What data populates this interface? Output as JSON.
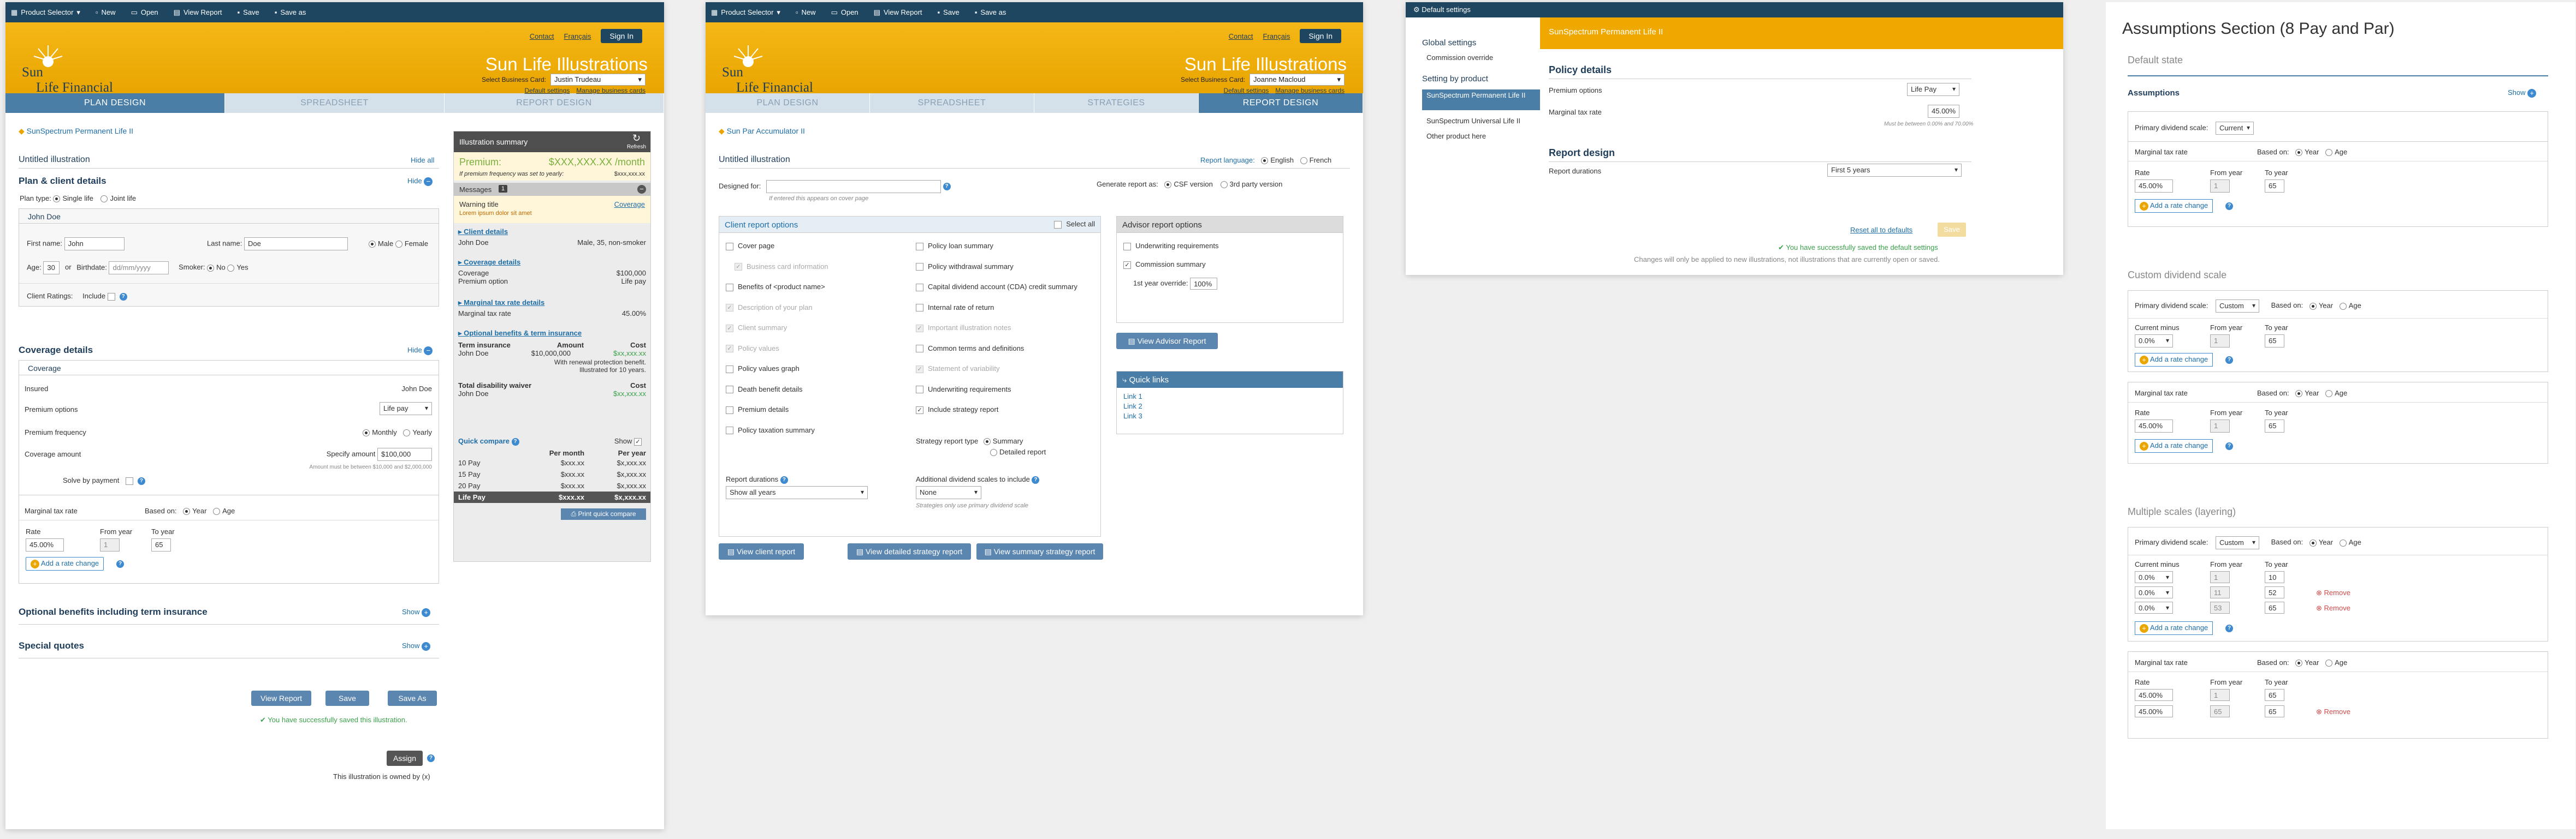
{
  "p1": {
    "toolbar": [
      "Product Selector",
      "New",
      "Open",
      "View Report",
      "Save",
      "Save as"
    ],
    "header": {
      "contact": "Contact",
      "francais": "Français",
      "signin": "Sign In",
      "title": "Sun Life Illustrations",
      "bc_label": "Select Business Card:",
      "bc_value": "Justin Trudeau",
      "default_settings": "Default settings",
      "manage_bc": "Manage business cards",
      "logo1": "Sun",
      "logo2": "Life Financial"
    },
    "tabs": [
      "PLAN DESIGN",
      "SPREADSHEET",
      "REPORT DESIGN"
    ],
    "product": "SunSpectrum Permanent Life II",
    "untitled": "Untitled illustration",
    "hide_all": "Hide all",
    "plan_client": "Plan & client details",
    "hide": "Hide",
    "plan_type": "Plan type:",
    "single": "Single life",
    "joint": "Joint life",
    "person": "John Doe",
    "first": "First name:",
    "first_v": "John",
    "last": "Last name:",
    "last_v": "Doe",
    "male": "Male",
    "female": "Female",
    "age": "Age:",
    "age_v": "30",
    "or": "or",
    "birth": "Birthdate:",
    "birth_ph": "dd/mm/yyyy",
    "smoker": "Smoker:",
    "no": "No",
    "yes": "Yes",
    "ratings": "Client Ratings:",
    "include": "Include",
    "coverage_details": "Coverage details",
    "coverage": "Coverage",
    "insured": "Insured",
    "insured_v": "John Doe",
    "premium_options": "Premium options",
    "premium_options_v": "Life pay",
    "premium_freq": "Premium frequency",
    "monthly": "Monthly",
    "yearly": "Yearly",
    "coverage_amount": "Coverage amount",
    "specify": "Specify amount",
    "amount_v": "$100,000",
    "amount_note": "Amount must be between $10,000 and $2,000,000",
    "solve": "Solve by payment",
    "mtr": "Marginal tax rate",
    "based": "Based on:",
    "year": "Year",
    "agel": "Age",
    "rate": "Rate",
    "from": "From year",
    "to": "To year",
    "rate_v": "45.00%",
    "from_v": "1",
    "to_v": "65",
    "add_rate": "Add a rate change",
    "optional": "Optional benefits including term insurance",
    "show": "Show",
    "special": "Special quotes",
    "view_report": "View Report",
    "save": "Save",
    "save_as": "Save As",
    "success": "You have successfully saved this illustration.",
    "assign": "Assign",
    "owned": "This illustration is owned by (x)",
    "summary": {
      "title": "Illustration summary",
      "refresh": "Refresh",
      "premium": "Premium:",
      "premium_v": "$XXX,XXX.XX /month",
      "note": "If premium frequency was set to yearly:",
      "note_v": "$xxx,xxx.xx",
      "messages": "Messages",
      "msg_count": "1",
      "warn": "Warning title",
      "warn_sub": "Lorem ipsum dolor sit amet",
      "cov_link": "Coverage",
      "client_details": "Client details",
      "cd_name": "John Doe",
      "cd_v": "Male, 35, non-smoker",
      "cov_details": "Coverage details",
      "cov": "Coverage",
      "cov_v": "$100,000",
      "po": "Premium option",
      "po_v": "Life pay",
      "mtr_details": "Marginal tax rate details",
      "mtr": "Marginal tax rate",
      "mtr_v": "45.00%",
      "opt": "Optional benefits & term insurance",
      "term": "Term insurance",
      "amount": "Amount",
      "cost": "Cost",
      "ti_name": "John Doe",
      "ti_amt": "$10,000,000",
      "ti_cost": "$xx,xxx.xx",
      "ti_note": "With renewal protection benefit. Illustrated for 10 years.",
      "tdw": "Total disability waiver",
      "tdw_cost": "Cost",
      "tdw_name": "John Doe",
      "tdw_v": "$xx,xxx.xx",
      "qc": "Quick compare",
      "qc_show": "Show",
      "per_month": "Per month",
      "per_year": "Per year",
      "qc_rows": [
        [
          "10 Pay",
          "$xxx.xx",
          "$x,xxx.xx"
        ],
        [
          "15 Pay",
          "$xxx.xx",
          "$x,xxx.xx"
        ],
        [
          "20 Pay",
          "$xxx.xx",
          "$x,xxx.xx"
        ],
        [
          "Life Pay",
          "$xxx.xx",
          "$x,xxx.xx"
        ]
      ],
      "print_qc": "Print quick compare"
    }
  },
  "p2": {
    "toolbar": [
      "Product Selector",
      "New",
      "Open",
      "View Report",
      "Save",
      "Save as"
    ],
    "header": {
      "contact": "Contact",
      "francais": "Français",
      "signin": "Sign In",
      "title": "Sun Life Illustrations",
      "bc_label": "Select Business Card:",
      "bc_value": "Joanne Macloud",
      "default_settings": "Default settings",
      "manage_bc": "Manage business cards",
      "logo1": "Sun",
      "logo2": "Life Financial"
    },
    "tabs": [
      "PLAN DESIGN",
      "SPREADSHEET",
      "STRATEGIES",
      "REPORT DESIGN"
    ],
    "product": "Sun Par Accumulator II",
    "untitled": "Untitled illustration",
    "report_lang": "Report language:",
    "english": "English",
    "french": "French",
    "designed_for": "Designed for:",
    "designed_note": "If entered this appears on cover page",
    "generate": "Generate report as:",
    "csf": "CSF version",
    "third": "3rd party version",
    "client_opts": "Client report options",
    "select_all": "Select all",
    "col1": [
      [
        "Cover page",
        "0"
      ],
      [
        "Business card information",
        "d"
      ],
      [
        "Benefits of <product name>",
        "0"
      ],
      [
        "Description of your plan",
        "d"
      ],
      [
        "Client summary",
        "d"
      ],
      [
        "Policy values",
        "d"
      ],
      [
        "Policy values graph",
        "0"
      ],
      [
        "Death benefit details",
        "0"
      ],
      [
        "Premium details",
        "0"
      ],
      [
        "Policy taxation summary",
        "0"
      ]
    ],
    "col2": [
      [
        "Policy loan summary",
        "0"
      ],
      [
        "Policy withdrawal summary",
        "0"
      ],
      [
        "Capital dividend account (CDA) credit summary",
        "0"
      ],
      [
        "Internal rate of return",
        "0"
      ],
      [
        "Important illustration notes",
        "d"
      ],
      [
        "Common terms and definitions",
        "0"
      ],
      [
        "Statement of variability",
        "d"
      ],
      [
        "Underwriting requirements",
        "0"
      ],
      [
        "Include strategy report",
        "1"
      ]
    ],
    "strategy_type": "Strategy report type",
    "summary": "Summary",
    "detailed": "Detailed report",
    "report_dur": "Report durations",
    "report_dur_v": "Show all years",
    "add_div": "Additional dividend scales to include",
    "none": "None",
    "strat_note": "Strategies only use primary dividend scale",
    "advisor": "Advisor report options",
    "uw": "Underwriting requirements",
    "commission": "Commission summary",
    "first_year": "1st year override:",
    "first_year_v": "100%",
    "view_adv": "View Advisor Report",
    "quick_links": "Quick links",
    "links": [
      "Link 1",
      "Link 2",
      "Link 3"
    ],
    "btn_client": "View client report",
    "btn_detailed": "View detailed strategy report",
    "btn_summary": "View summary strategy report"
  },
  "p3": {
    "title": "Default settings",
    "global": "Global settings",
    "comm": "Commission override",
    "by_product": "Setting by product",
    "products": [
      "SunSpectrum Permanent Life II",
      "SunSpectrum Universal Life II",
      "Other product here"
    ],
    "banner": "SunSpectrum Permanent Life II",
    "policy": "Policy details",
    "premium_options": "Premium options",
    "premium_v": "Life Pay",
    "mtr": "Marginal tax rate",
    "mtr_v": "45.00%",
    "mtr_note": "Must be between 0.00% and 70.00%",
    "report_design": "Report design",
    "report_dur": "Report durations",
    "report_dur_v": "First 5 years",
    "reset": "Reset all to defaults",
    "save": "Save",
    "success": "You have successfully saved the default settings",
    "changes": "Changes will only be applied to new illustrations, not illustrations that are currently open or saved."
  },
  "p4": {
    "title": "Assumptions Section (8 Pay and Par)",
    "default_state": "Default state",
    "assumptions": "Assumptions",
    "show": "Show",
    "pds": "Primary dividend scale:",
    "current": "Current",
    "custom": "Custom",
    "based": "Based on:",
    "year": "Year",
    "age": "Age",
    "mtr": "Marginal tax rate",
    "rate": "Rate",
    "from": "From year",
    "to": "To year",
    "rate_v": "45.00%",
    "from_v": "1",
    "to_v": "65",
    "add": "Add a rate change",
    "custom_title": "Custom dividend scale",
    "cur_minus": "Current minus",
    "zero": "0.0%",
    "multi_title": "Multiple scales (layering)",
    "multi_rows": [
      [
        "0.0%",
        "1",
        "10"
      ],
      [
        "0.0%",
        "11",
        "52"
      ],
      [
        "0.0%",
        "53",
        "65"
      ]
    ],
    "remove": "Remove",
    "multi_rates": [
      [
        "45.00%",
        "1",
        "65"
      ],
      [
        "45.00%",
        "65",
        "65"
      ]
    ]
  }
}
